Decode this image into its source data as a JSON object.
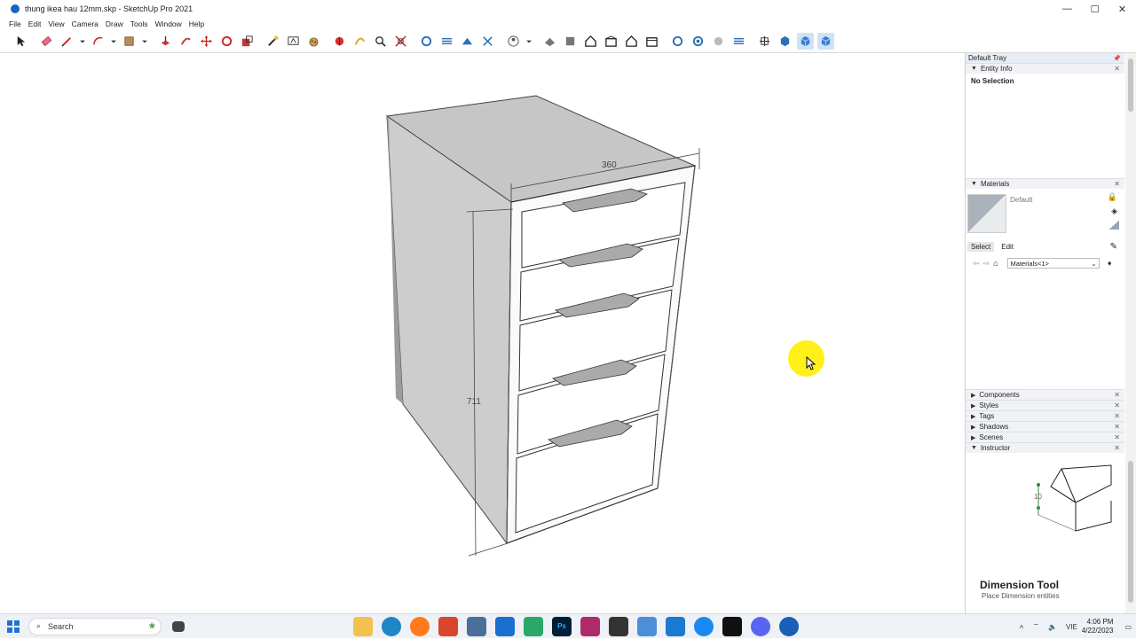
{
  "window": {
    "title": "thung ikea hau 12mm.skp - SketchUp Pro 2021",
    "controls": [
      "—",
      "☐",
      "✕"
    ]
  },
  "menu": [
    "File",
    "Edit",
    "View",
    "Camera",
    "Draw",
    "Tools",
    "Window",
    "Help"
  ],
  "toolbar": {
    "tools": [
      "select-icon",
      "eraser-icon",
      "pencil-line-icon",
      "dropdown-icon",
      "arc-icon",
      "dropdown-icon",
      "rectangle-icon",
      "dropdown-icon",
      "push-pull-icon",
      "follow-me-icon",
      "move-icon",
      "rotate-icon",
      "scale-icon",
      "tape-measure-icon",
      "text-icon",
      "paint-bucket-icon",
      "section-plane-icon",
      "orbit-icon",
      "zoom-icon",
      "zoom-extents-icon",
      "undo-view-icon",
      "camera-icon",
      "walk-icon",
      "user-icon",
      "dropdown-icon",
      "iso-view-icon",
      "top-view-icon",
      "front-view-icon",
      "right-view-icon",
      "back-view-icon",
      "left-view-icon",
      "components-icon",
      "materials-icon",
      "styles-icon",
      "tags-icon",
      "x-ray-icon",
      "back-edges-icon",
      "shaded-icon",
      "textured-icon"
    ]
  },
  "viewport": {
    "dimensions": {
      "width": "360",
      "height": "711"
    }
  },
  "tray": {
    "title": "Default Tray",
    "entity_info": {
      "label": "Entity Info",
      "status": "No Selection"
    },
    "materials": {
      "label": "Materials",
      "current": "Default",
      "tab_select": "Select",
      "tab_edit": "Edit",
      "library": "Materials<1>"
    },
    "collapsed_panels": [
      "Components",
      "Styles",
      "Tags",
      "Shadows",
      "Scenes"
    ],
    "instructor": {
      "label": "Instructor",
      "tool_title": "Dimension Tool",
      "tool_subtitle": "Place Dimension entities",
      "figure_label": "10"
    }
  },
  "taskbar": {
    "search_placeholder": "Search",
    "language": "VIE",
    "time": "4:06 PM",
    "date": "4/22/2023"
  }
}
